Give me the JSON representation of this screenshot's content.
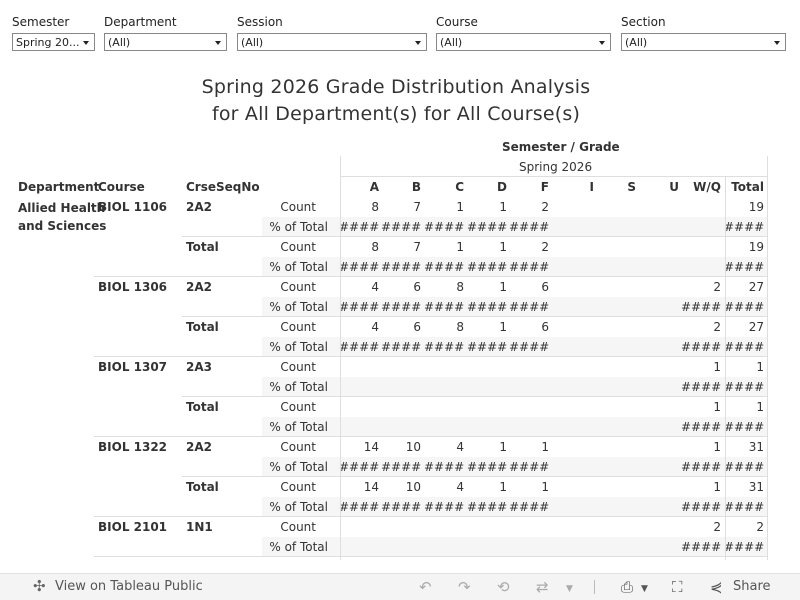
{
  "filters": [
    {
      "label": "Semester",
      "value": "Spring 20..."
    },
    {
      "label": "Department",
      "value": "(All)"
    },
    {
      "label": "Session",
      "value": "(All)"
    },
    {
      "label": "Course",
      "value": "(All)"
    },
    {
      "label": "Section",
      "value": "(All)"
    }
  ],
  "title": {
    "line1": "Spring 2026 Grade Distribution Analysis",
    "line2": "for All Department(s) for All Course(s)"
  },
  "table": {
    "header_group": "Semester  /  Grade",
    "semester": "Spring 2026",
    "row_headers": [
      "Department",
      "Course",
      "CrseSeqNo"
    ],
    "grade_columns": [
      "A",
      "B",
      "C",
      "D",
      "F",
      "I",
      "S",
      "U",
      "W/Q",
      "Total"
    ],
    "measures": {
      "count": "Count",
      "pct": "% of Total"
    },
    "department": "Allied Health and Sciences",
    "department_lines": [
      "Allied Health",
      "and Sciences"
    ],
    "hash": "####",
    "total_label": "Total",
    "courses": [
      {
        "course": "BIOL 1106",
        "sections": [
          {
            "label": "2A2",
            "count": [
              "8",
              "7",
              "1",
              "1",
              "2",
              "",
              "",
              "",
              "",
              "19"
            ],
            "pct": [
              "####",
              "####",
              "####",
              "####",
              "####",
              "",
              "",
              "",
              "",
              "####"
            ]
          },
          {
            "label": "Total",
            "count": [
              "8",
              "7",
              "1",
              "1",
              "2",
              "",
              "",
              "",
              "",
              "19"
            ],
            "pct": [
              "####",
              "####",
              "####",
              "####",
              "####",
              "",
              "",
              "",
              "",
              "####"
            ]
          }
        ]
      },
      {
        "course": "BIOL 1306",
        "sections": [
          {
            "label": "2A2",
            "count": [
              "4",
              "6",
              "8",
              "1",
              "6",
              "",
              "",
              "",
              "2",
              "27"
            ],
            "pct": [
              "####",
              "####",
              "####",
              "####",
              "####",
              "",
              "",
              "",
              "####",
              "####"
            ]
          },
          {
            "label": "Total",
            "count": [
              "4",
              "6",
              "8",
              "1",
              "6",
              "",
              "",
              "",
              "2",
              "27"
            ],
            "pct": [
              "####",
              "####",
              "####",
              "####",
              "####",
              "",
              "",
              "",
              "####",
              "####"
            ]
          }
        ]
      },
      {
        "course": "BIOL 1307",
        "sections": [
          {
            "label": "2A3",
            "count": [
              "",
              "",
              "",
              "",
              "",
              "",
              "",
              "",
              "1",
              "1"
            ],
            "pct": [
              "",
              "",
              "",
              "",
              "",
              "",
              "",
              "",
              "####",
              "####"
            ]
          },
          {
            "label": "Total",
            "count": [
              "",
              "",
              "",
              "",
              "",
              "",
              "",
              "",
              "1",
              "1"
            ],
            "pct": [
              "",
              "",
              "",
              "",
              "",
              "",
              "",
              "",
              "####",
              "####"
            ]
          }
        ]
      },
      {
        "course": "BIOL 1322",
        "sections": [
          {
            "label": "2A2",
            "count": [
              "14",
              "10",
              "4",
              "1",
              "1",
              "",
              "",
              "",
              "1",
              "31"
            ],
            "pct": [
              "####",
              "####",
              "####",
              "####",
              "####",
              "",
              "",
              "",
              "####",
              "####"
            ]
          },
          {
            "label": "Total",
            "count": [
              "14",
              "10",
              "4",
              "1",
              "1",
              "",
              "",
              "",
              "1",
              "31"
            ],
            "pct": [
              "####",
              "####",
              "####",
              "####",
              "####",
              "",
              "",
              "",
              "####",
              "####"
            ]
          }
        ]
      },
      {
        "course": "BIOL 2101",
        "sections": [
          {
            "label": "1N1",
            "count": [
              "",
              "",
              "",
              "",
              "",
              "",
              "",
              "",
              "2",
              "2"
            ],
            "pct": [
              "",
              "",
              "",
              "",
              "",
              "",
              "",
              "",
              "####",
              "####"
            ]
          }
        ]
      }
    ]
  },
  "toolbar": {
    "view_label": "View on Tableau Public",
    "share_label": "Share",
    "icons": [
      "tableau-logo-icon",
      "undo-icon",
      "redo-icon",
      "revert-icon",
      "refresh-icon",
      "download-icon",
      "fullscreen-icon",
      "share-icon"
    ]
  }
}
